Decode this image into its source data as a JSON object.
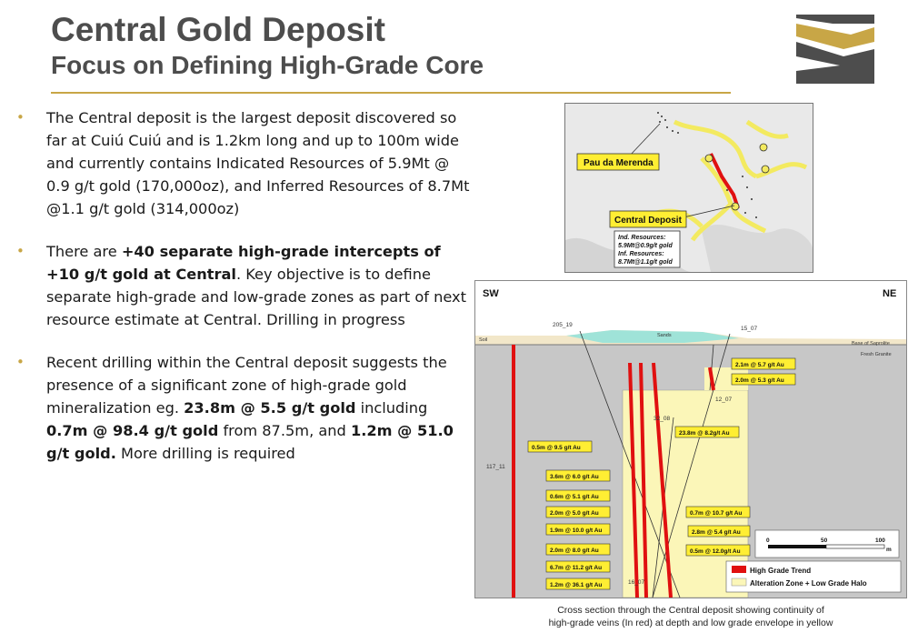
{
  "header": {
    "title": "Central Gold Deposit",
    "subtitle": "Focus on Defining High-Grade Core"
  },
  "bullets": [
    {
      "segments": [
        {
          "text": "The Central deposit is the largest deposit discovered so far at Cuiú Cuiú and is 1.2km long and up to 100m wide  and currently contains Indicated Resources of 5.9Mt @ 0.9 g/t gold (170,000oz), and Inferred Resources of 8.7Mt @1.1 g/t gold (314,000oz)",
          "bold": false
        }
      ]
    },
    {
      "segments": [
        {
          "text": "There are ",
          "bold": false
        },
        {
          "text": "+40 separate high-grade intercepts of +10 g/t gold at Central",
          "bold": true
        },
        {
          "text": ". Key objective is to define separate high-grade and low-grade zones as part of next resource estimate at Central. Drilling in progress",
          "bold": false
        }
      ]
    },
    {
      "segments": [
        {
          "text": "Recent drilling within the Central deposit suggests the presence of a significant zone of high-grade gold mineralization eg. ",
          "bold": false
        },
        {
          "text": "23.8m @ 5.5 g/t gold",
          "bold": true
        },
        {
          "text": " including ",
          "bold": false
        },
        {
          "text": "0.7m @ 98.4 g/t gold",
          "bold": true
        },
        {
          "text": " from 87.5m, and ",
          "bold": false
        },
        {
          "text": "1.2m @ 51.0 g/t gold.",
          "bold": true
        },
        {
          "text": " More drilling is required",
          "bold": false
        }
      ]
    }
  ],
  "map": {
    "pau_label": "Pau da Merenda",
    "central_label": "Central Deposit",
    "resources_title": "Ind. Resources:",
    "resources_ind": "5.9Mt@0.9g/t gold",
    "resources_inf_title": "Inf. Resources:",
    "resources_inf": "8.7Mt@1.1g/t gold"
  },
  "section": {
    "sw": "SW",
    "ne": "NE",
    "soil": "Soil",
    "sands": "Sands",
    "saprolite": "Base of Saprolite",
    "granite": "Fresh Granite",
    "holes": [
      "205_19",
      "15_07",
      "12_07",
      "32_08",
      "117_11",
      "16_07"
    ],
    "intercepts": [
      "2.1m @ 5.7 g/t Au",
      "2.0m @ 5.3 g/t Au",
      "23.8m @ 8.2g/t Au",
      "0.5m @ 9.5 g/t Au",
      "3.6m @ 6.0 g/t Au",
      "0.6m @ 5.1 g/t Au",
      "2.0m @ 5.0 g/t Au",
      "1.9m @ 10.0 g/t Au",
      "2.0m @ 8.0 g/t Au",
      "6.7m @ 11.2 g/t Au",
      "1.2m @ 36.1 g/t Au",
      "0.7m @ 10.7 g/t Au",
      "2.8m @ 5.4 g/t Au",
      "0.5m @ 12.0g/t Au"
    ],
    "scale": {
      "zero": "0",
      "mid": "50",
      "end": "100",
      "unit": "m"
    },
    "legend": {
      "high_grade": "High Grade Trend",
      "halo": "Alteration Zone + Low Grade Halo"
    },
    "colors": {
      "vein": "#e01010",
      "halo": "#fbf6b8",
      "sands": "#9fe3d8",
      "label": "#ffee33"
    }
  },
  "caption": {
    "line1": "Cross section through the Central deposit showing continuity of",
    "line2": "high-grade veins (In red) at depth and low grade envelope in yellow"
  }
}
